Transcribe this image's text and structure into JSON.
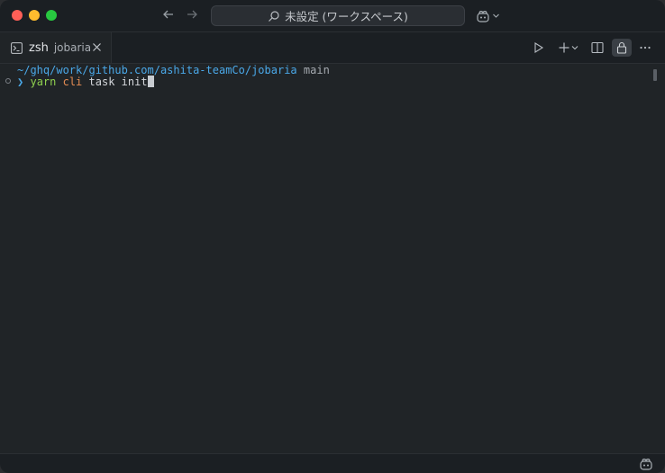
{
  "titlebar": {
    "command_center_text": "未設定 (ワークスペース)",
    "icons": {
      "back": "arrow-left-icon",
      "forward": "arrow-right-icon",
      "search": "search-icon",
      "copilot": "copilot-icon"
    }
  },
  "tab": {
    "name": "zsh",
    "description": "jobaria",
    "icons": {
      "terminal": "terminal-icon",
      "close": "close-icon"
    }
  },
  "toolbar": {
    "icons": [
      "run-icon",
      "add-icon",
      "chevron-down-icon",
      "split-icon",
      "lock-icon",
      "more-icon"
    ]
  },
  "terminal": {
    "path": "~/ghq/work/github.com/ashita-teamCo/jobaria",
    "branch": "main",
    "prompt": "❯",
    "cmd_yarn": "yarn",
    "cmd_cli": "cli",
    "cmd_args": "task init"
  },
  "colors": {
    "background": "#202427",
    "path": "#4aa8e8",
    "yarn": "#8fd14f",
    "cli": "#e38b53"
  }
}
